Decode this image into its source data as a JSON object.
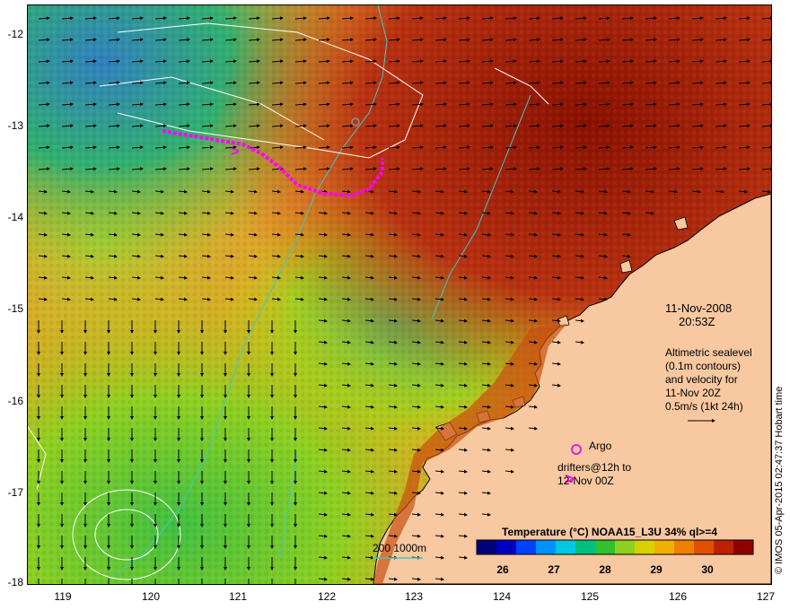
{
  "map": {
    "date_line1": "11-Nov-2008",
    "date_line2": "20:53Z",
    "altimetry_lines": [
      "Altimetric sealevel",
      "(0.1m contours)",
      "and velocity for",
      "11-Nov 20Z",
      "0.5m/s (1kt 24h)"
    ],
    "legend_argo": "Argo",
    "legend_drifters_line1": "drifters@12h to",
    "legend_drifters_line2": "12-Nov 00Z",
    "depth_legend": "200  1000m",
    "watermark": "© IMOS 05-Apr-2015 02:47:37 Hobart time",
    "x_ticks": [
      "119",
      "120",
      "121",
      "122",
      "123",
      "124",
      "125",
      "126",
      "127"
    ],
    "y_ticks": [
      "-12",
      "-13",
      "-14",
      "-15",
      "-16",
      "-17",
      "-18"
    ],
    "colorbar": {
      "title": "Temperature (°C) NOAA15_L3U 34% ql>=4",
      "ticks": [
        "26",
        "27",
        "28",
        "29",
        "30"
      ],
      "range": [
        25.5,
        31
      ]
    },
    "colors": {
      "land": "#f8c8a0",
      "argo": "#e020e0",
      "drifter": "#ff00ff",
      "isobath": "#40c8c8",
      "contour": "#ffffff"
    }
  }
}
